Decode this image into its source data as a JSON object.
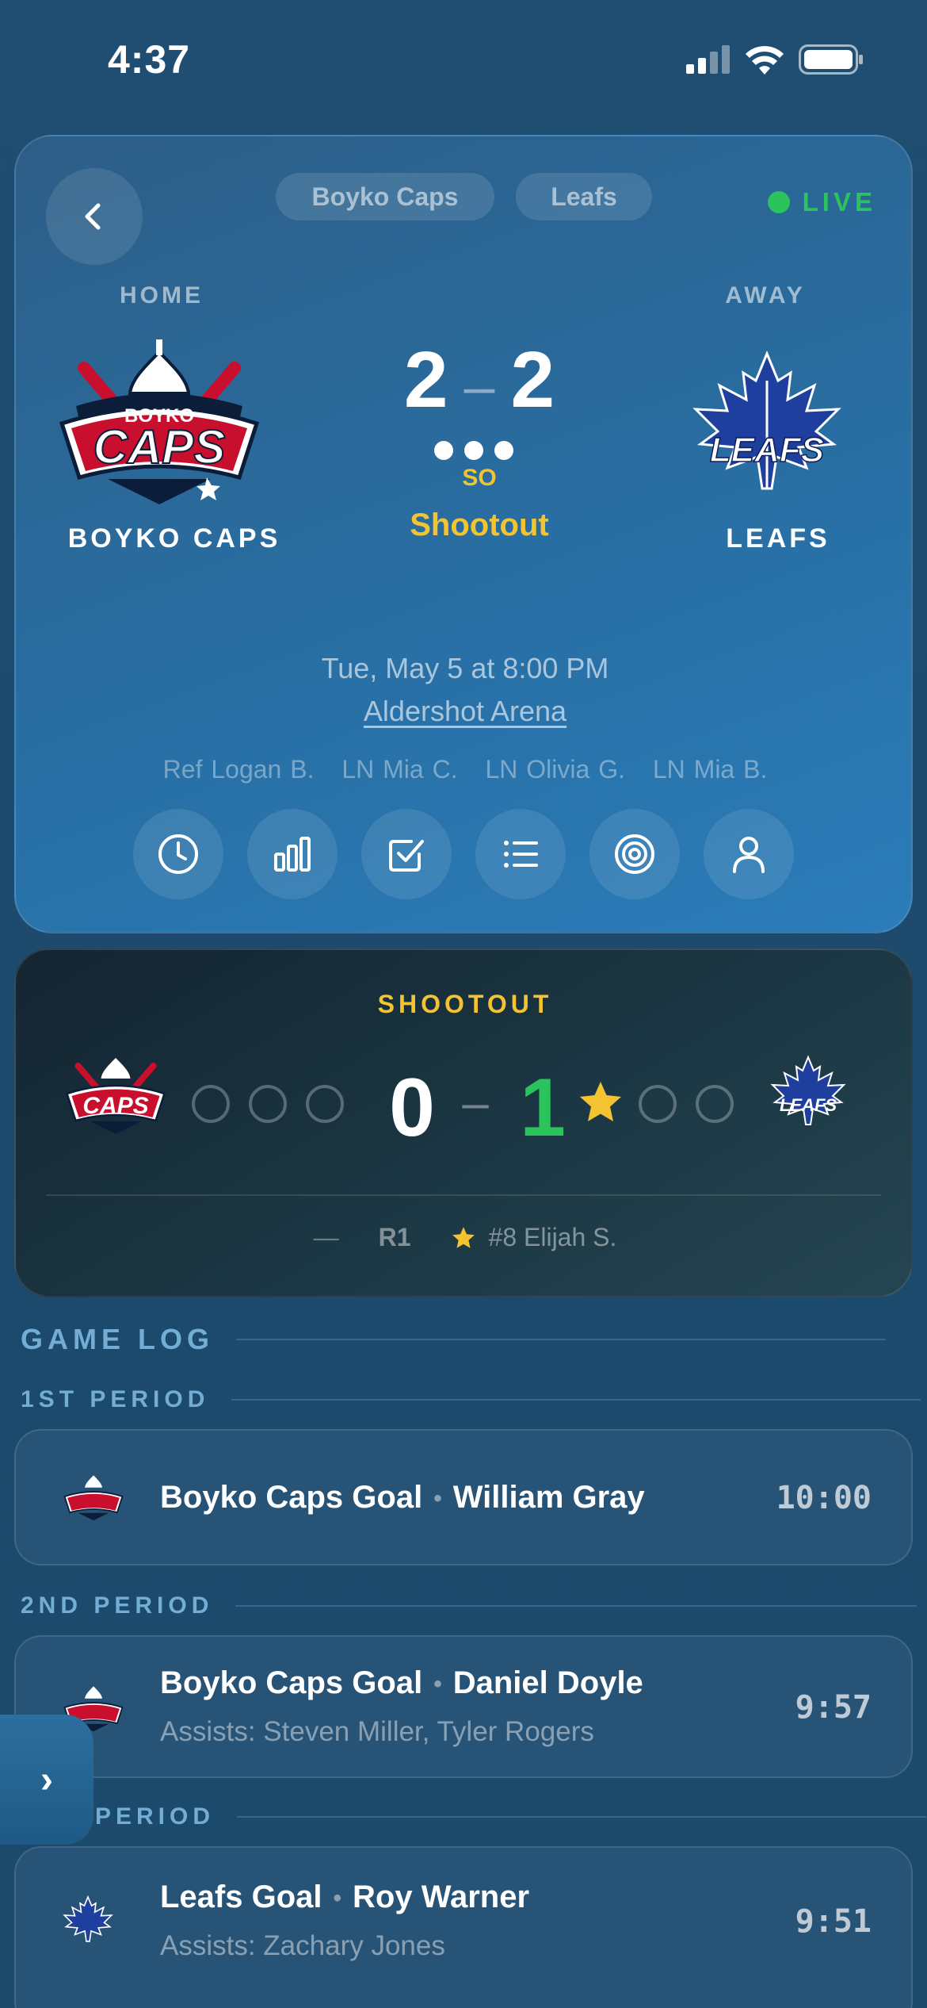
{
  "status_bar": {
    "time": "4:37"
  },
  "game": {
    "chips": [
      "Boyko Caps",
      "Leafs"
    ],
    "live_label": "LIVE",
    "home_label": "HOME",
    "away_label": "AWAY",
    "home_team": "BOYKO CAPS",
    "away_team": "LEAFS",
    "home_score": "2",
    "away_score": "2",
    "score_separator": "–",
    "so_abbrev": "SO",
    "status": "Shootout",
    "datetime": "Tue, May 5 at 8:00 PM",
    "arena": "Aldershot Arena",
    "officials": [
      "Ref Logan B.",
      "LN Mia C.",
      "LN Olivia G.",
      "LN Mia B."
    ],
    "logo_text": {
      "home_top": "BOYKO",
      "home_main": "CAPS",
      "away_main": "LEAFS"
    },
    "actions": [
      "clock-icon",
      "bar-chart-icon",
      "checkbox-icon",
      "list-icon",
      "target-icon",
      "person-icon"
    ]
  },
  "shootout": {
    "title": "SHOOTOUT",
    "home_score": "0",
    "separator": "–",
    "away_score": "1",
    "round_home": "—",
    "round_label": "R1",
    "round_away": "#8 Elijah S."
  },
  "game_log": {
    "title": "GAME LOG",
    "periods": [
      {
        "label": "1ST PERIOD",
        "events": [
          {
            "team": "Boyko Caps Goal",
            "player": "William Gray",
            "assists": "",
            "time": "10:00"
          }
        ]
      },
      {
        "label": "2ND PERIOD",
        "events": [
          {
            "team": "Boyko Caps Goal",
            "player": "Daniel Doyle",
            "assists": "Assists: Steven Miller, Tyler Rogers",
            "time": "9:57"
          }
        ]
      },
      {
        "label": "PERIOD",
        "events": [
          {
            "team": "Leafs Goal",
            "player": "Roy Warner",
            "assists": "Assists: Zachary Jones",
            "time": "9:51"
          }
        ]
      }
    ]
  },
  "side_tab": {
    "label": "›"
  },
  "colors": {
    "live": "#2bc35c",
    "accent_gold": "#f4c430",
    "caps_red": "#c8102e",
    "leafs_blue": "#1e3f9e"
  }
}
